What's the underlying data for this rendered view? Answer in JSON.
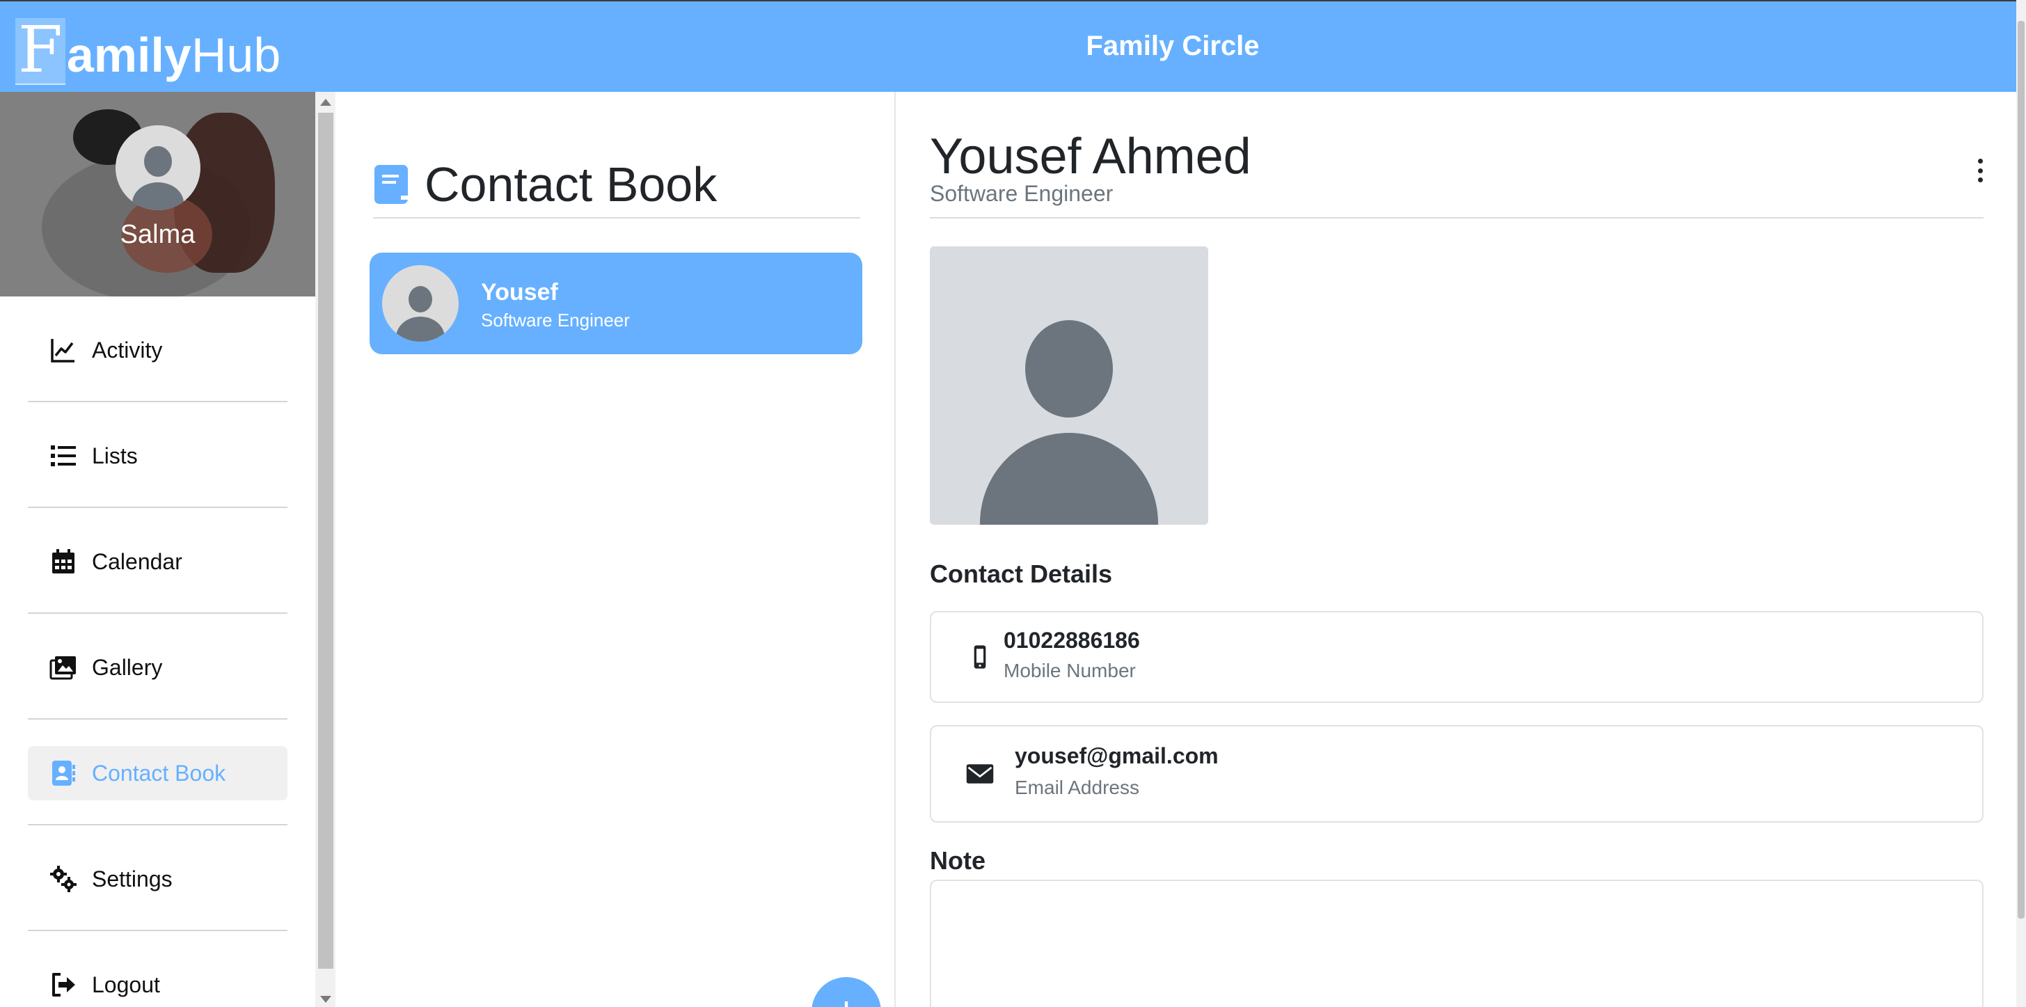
{
  "app": {
    "logo_initial": "F",
    "logo_amily": "amily",
    "logo_hub": "Hub",
    "header_title": "Family Circle"
  },
  "profile": {
    "name": "Salma"
  },
  "nav": {
    "items": [
      {
        "label": "Activity",
        "icon": "chart-line-icon"
      },
      {
        "label": "Lists",
        "icon": "list-icon"
      },
      {
        "label": "Calendar",
        "icon": "calendar-icon"
      },
      {
        "label": "Gallery",
        "icon": "images-icon"
      },
      {
        "label": "Contact Book",
        "icon": "address-book-icon",
        "active": true
      },
      {
        "label": "Settings",
        "icon": "gears-icon"
      },
      {
        "label": "Logout",
        "icon": "logout-icon"
      }
    ]
  },
  "contact_list": {
    "title": "Contact Book",
    "contacts": [
      {
        "name": "Yousef",
        "role": "Software Engineer",
        "selected": true
      }
    ]
  },
  "detail": {
    "name": "Yousef Ahmed",
    "role": "Software Engineer",
    "contact_details_title": "Contact Details",
    "mobile": {
      "value": "01022886186",
      "label": "Mobile Number"
    },
    "email": {
      "value": "yousef@gmail.com",
      "label": "Email Address"
    },
    "note_title": "Note",
    "note": ""
  },
  "colors": {
    "accent": "#66b0ff",
    "text": "#212529",
    "muted": "#6c757d",
    "avatar_placeholder": "#6c757d"
  }
}
